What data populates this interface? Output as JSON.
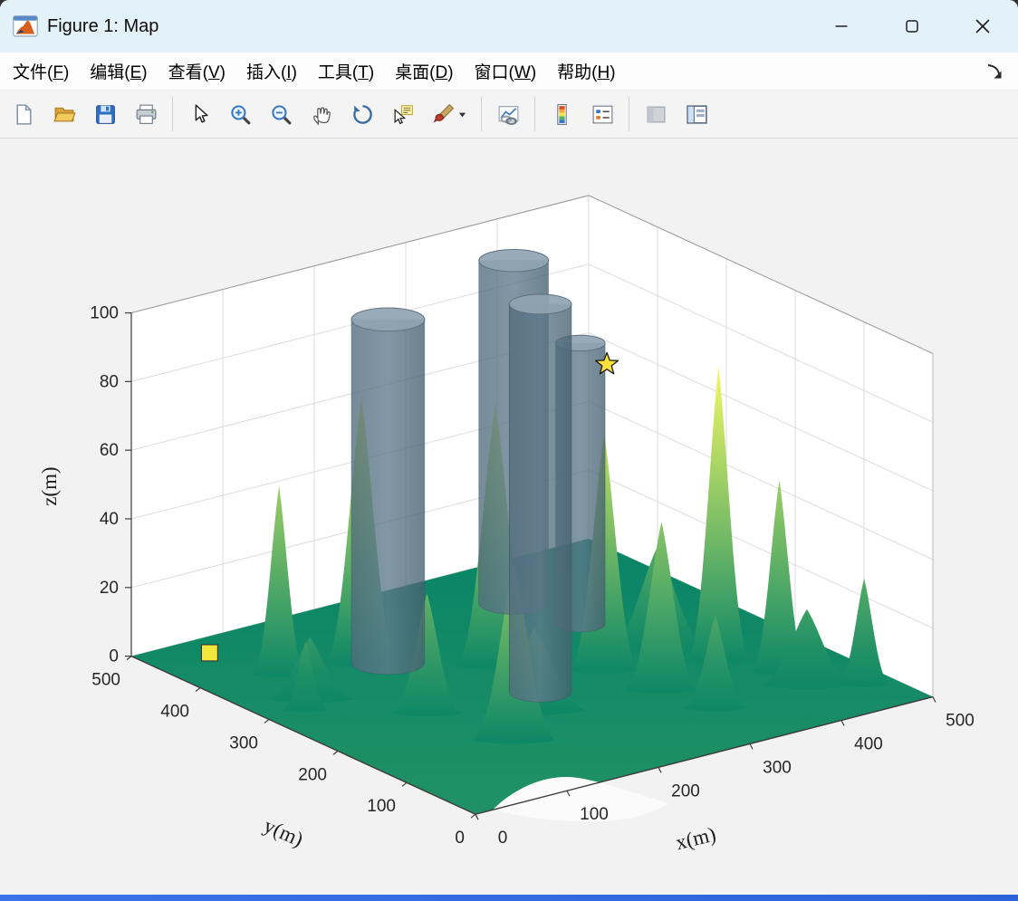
{
  "window": {
    "title": "Figure 1: Map",
    "icon": "matlab-figure-icon"
  },
  "menu_bar": {
    "items": [
      {
        "id": "file",
        "pre": "文件(",
        "key": "F",
        "post": ")"
      },
      {
        "id": "edit",
        "pre": "编辑(",
        "key": "E",
        "post": ")"
      },
      {
        "id": "view",
        "pre": "查看(",
        "key": "V",
        "post": ")"
      },
      {
        "id": "insert",
        "pre": "插入(",
        "key": "I",
        "post": ")"
      },
      {
        "id": "tools",
        "pre": "工具(",
        "key": "T",
        "post": ")"
      },
      {
        "id": "desktop",
        "pre": "桌面(",
        "key": "D",
        "post": ")"
      },
      {
        "id": "window",
        "pre": "窗口(",
        "key": "W",
        "post": ")"
      },
      {
        "id": "help",
        "pre": "帮助(",
        "key": "H",
        "post": ")"
      }
    ],
    "dock_arrow_icon": "dock-arrow-icon"
  },
  "toolbar": {
    "buttons": [
      {
        "name": "new-figure",
        "icon": "new-figure-icon"
      },
      {
        "name": "open-file",
        "icon": "open-folder-icon"
      },
      {
        "name": "save-figure",
        "icon": "save-icon"
      },
      {
        "name": "print-figure",
        "icon": "print-icon"
      },
      {
        "separator": true
      },
      {
        "name": "edit-plot",
        "icon": "pointer-icon"
      },
      {
        "name": "zoom-in",
        "icon": "zoom-in-icon"
      },
      {
        "name": "zoom-out",
        "icon": "zoom-out-icon"
      },
      {
        "name": "pan",
        "icon": "hand-icon"
      },
      {
        "name": "rotate-3d",
        "icon": "rotate-icon"
      },
      {
        "name": "data-cursor",
        "icon": "data-cursor-icon"
      },
      {
        "name": "brush-data",
        "icon": "brush-icon",
        "dropdown": true
      },
      {
        "separator": true
      },
      {
        "name": "link-plot",
        "icon": "link-plot-icon"
      },
      {
        "separator": true
      },
      {
        "name": "insert-colorbar",
        "icon": "colorbar-icon"
      },
      {
        "name": "insert-legend",
        "icon": "legend-icon"
      },
      {
        "separator": true
      },
      {
        "name": "hide-plot-tools",
        "icon": "hide-plot-tools-icon",
        "disabled": true
      },
      {
        "name": "show-plot-tools",
        "icon": "show-plot-tools-icon"
      }
    ]
  },
  "chart_data": {
    "type": "surface",
    "projection": "3d",
    "title": "",
    "xlabel": "x(m)",
    "ylabel": "y(m)",
    "zlabel": "z(m)",
    "xlim": [
      0,
      500
    ],
    "ylim": [
      0,
      500
    ],
    "zlim": [
      0,
      100
    ],
    "xticks": [
      0,
      100,
      200,
      300,
      400,
      500
    ],
    "yticks": [
      0,
      100,
      200,
      300,
      400,
      500
    ],
    "zticks": [
      0,
      20,
      40,
      60,
      80,
      100
    ],
    "grid": true,
    "colormap": "summer",
    "colors": {
      "surface_low": "#008066",
      "surface_high": "#ffff66",
      "obstacle": "#5a7486",
      "marker_yellow": "#f2e73b"
    },
    "terrain_peaks": [
      {
        "x": 405,
        "y": 185,
        "height": 86,
        "spread": 36
      },
      {
        "x": 150,
        "y": 365,
        "height": 78,
        "spread": 42
      },
      {
        "x": 240,
        "y": 290,
        "height": 77,
        "spread": 45
      },
      {
        "x": 310,
        "y": 225,
        "height": 69,
        "spread": 40
      },
      {
        "x": 430,
        "y": 130,
        "height": 56,
        "spread": 32
      },
      {
        "x": 75,
        "y": 385,
        "height": 55,
        "spread": 30
      },
      {
        "x": 140,
        "y": 130,
        "height": 52,
        "spread": 48
      },
      {
        "x": 320,
        "y": 155,
        "height": 49,
        "spread": 42
      },
      {
        "x": 120,
        "y": 230,
        "height": 35,
        "spread": 40
      },
      {
        "x": 470,
        "y": 60,
        "height": 31,
        "spread": 30
      },
      {
        "x": 380,
        "y": 240,
        "height": 30,
        "spread": 60
      },
      {
        "x": 330,
        "y": 90,
        "height": 27,
        "spread": 36
      },
      {
        "x": 200,
        "y": 180,
        "height": 24,
        "spread": 60
      },
      {
        "x": 430,
        "y": 90,
        "height": 22,
        "spread": 55
      },
      {
        "x": 40,
        "y": 300,
        "height": 20,
        "spread": 26
      },
      {
        "x": 60,
        "y": 320,
        "height": 18,
        "spread": 50
      }
    ],
    "obstacles": [
      {
        "shape": "cylinder",
        "x": 348,
        "y": 407,
        "radius": 38,
        "height": 100
      },
      {
        "shape": "cylinder",
        "x": 170,
        "y": 353,
        "radius": 40,
        "height": 100
      },
      {
        "shape": "cylinder",
        "x": 363,
        "y": 330,
        "radius": 27,
        "height": 82
      },
      {
        "shape": "cylinder",
        "x": 232,
        "y": 214,
        "radius": 34,
        "height": 113
      }
    ],
    "markers": {
      "start": {
        "shape": "square",
        "color": "#f2e73b",
        "x": 60,
        "y": 466,
        "z": 0
      },
      "goal": {
        "shape": "star",
        "color": "#ffe13d",
        "x": 255,
        "y": 148,
        "z": 100
      }
    }
  }
}
